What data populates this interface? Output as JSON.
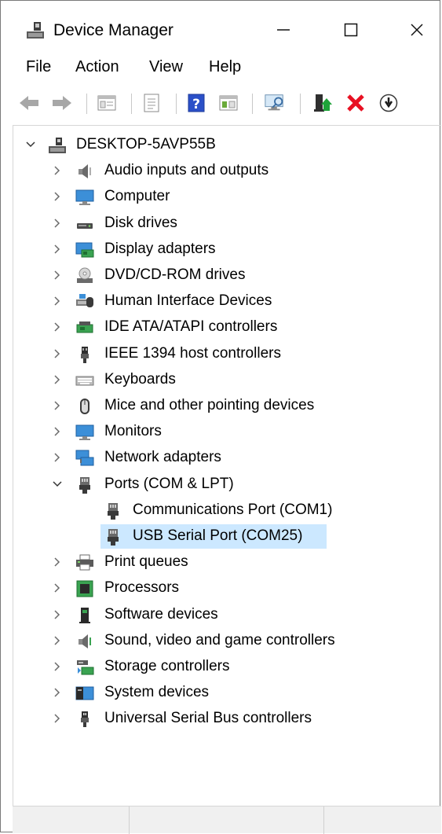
{
  "window": {
    "title": "Device Manager",
    "caption": {
      "minimize": "—",
      "maximize": "☐",
      "close": "✕"
    }
  },
  "menu": {
    "file": "File",
    "action": "Action",
    "view": "View",
    "help": "Help"
  },
  "toolbar": {
    "buttons": [
      "back-icon",
      "forward-icon",
      "properties-view-icon",
      "properties-icon",
      "help-icon",
      "show-hidden-icon",
      "scan-hardware-icon",
      "update-driver-icon",
      "uninstall-icon",
      "disable-device-icon"
    ]
  },
  "tree": {
    "root": "DESKTOP-5AVP55B",
    "items": [
      {
        "label": "Audio inputs and outputs",
        "icon": "speaker-icon",
        "expanded": false
      },
      {
        "label": "Computer",
        "icon": "computer-icon",
        "expanded": false
      },
      {
        "label": "Disk drives",
        "icon": "disk-drive-icon",
        "expanded": false
      },
      {
        "label": "Display adapters",
        "icon": "display-adapter-icon",
        "expanded": false
      },
      {
        "label": "DVD/CD-ROM drives",
        "icon": "dvd-drive-icon",
        "expanded": false
      },
      {
        "label": "Human Interface Devices",
        "icon": "hid-icon",
        "expanded": false
      },
      {
        "label": "IDE ATA/ATAPI controllers",
        "icon": "ide-controller-icon",
        "expanded": false
      },
      {
        "label": "IEEE 1394 host controllers",
        "icon": "ieee1394-icon",
        "expanded": false
      },
      {
        "label": "Keyboards",
        "icon": "keyboard-icon",
        "expanded": false
      },
      {
        "label": "Mice and other pointing devices",
        "icon": "mouse-icon",
        "expanded": false
      },
      {
        "label": "Monitors",
        "icon": "monitor-icon",
        "expanded": false
      },
      {
        "label": "Network adapters",
        "icon": "network-adapter-icon",
        "expanded": false
      },
      {
        "label": "Ports (COM & LPT)",
        "icon": "port-icon",
        "expanded": true,
        "children": [
          {
            "label": "Communications Port (COM1)",
            "icon": "port-icon",
            "selected": false
          },
          {
            "label": "USB Serial Port (COM25)",
            "icon": "port-icon",
            "selected": true
          }
        ]
      },
      {
        "label": "Print queues",
        "icon": "printer-icon",
        "expanded": false
      },
      {
        "label": "Processors",
        "icon": "processor-icon",
        "expanded": false
      },
      {
        "label": "Software devices",
        "icon": "software-device-icon",
        "expanded": false
      },
      {
        "label": "Sound, video and game controllers",
        "icon": "sound-controller-icon",
        "expanded": false
      },
      {
        "label": "Storage controllers",
        "icon": "storage-controller-icon",
        "expanded": false
      },
      {
        "label": "System devices",
        "icon": "system-devices-icon",
        "expanded": false
      },
      {
        "label": "Universal Serial Bus controllers",
        "icon": "usb-icon",
        "expanded": false
      }
    ]
  },
  "colors": {
    "selection": "#cce8ff",
    "accent": "#0078d7",
    "uninstall_red": "#e81123"
  }
}
